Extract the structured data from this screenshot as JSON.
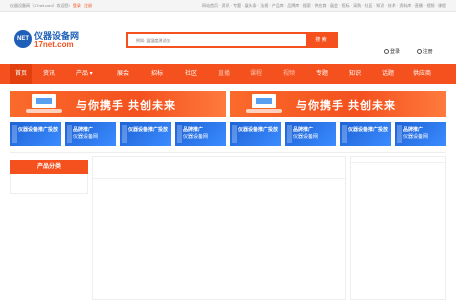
{
  "topbar": {
    "welcome": "仪器设备网（17net.com）欢迎您!",
    "login": "登录",
    "register": "注册",
    "links": "网站首页 · 资讯 · 专题 · 展头条 · 法规 · 产品库 · 品牌库 · 搜索 · 供应商 · 展会 · 招标 · 采购 · 社区 · 知识 · 技术 · 资料库 · 直播 · 视频 · 课程"
  },
  "logo": {
    "badge": "NET",
    "cn": "仪器设备网",
    "en": "17net.com"
  },
  "search": {
    "placeholder": "例如: 温湿度测试仪",
    "button": "搜 索"
  },
  "user": {
    "login": "登录",
    "register": "注册"
  },
  "nav": {
    "items": [
      "首页",
      "资讯",
      "产品 ▾",
      "展会",
      "招标",
      "社区",
      "直播",
      "课程",
      "视频",
      "专题",
      "知识",
      "话题",
      "供应商"
    ]
  },
  "banners": [
    {
      "slogan": "与你携手 共创未来"
    },
    {
      "slogan": "与你携手 共创未来"
    }
  ],
  "ads": [
    {
      "title": "仪器设备推广投放",
      "sub": ""
    },
    {
      "title": "品牌推广",
      "sub": "仪器设备网"
    },
    {
      "title": "仪器设备推广投放",
      "sub": ""
    },
    {
      "title": "品牌推广",
      "sub": "仪器设备网"
    },
    {
      "title": "仪器设备推广投放",
      "sub": ""
    },
    {
      "title": "品牌推广",
      "sub": "仪器设备网"
    },
    {
      "title": "仪器设备推广投放",
      "sub": ""
    },
    {
      "title": "品牌推广",
      "sub": "仪器设备网"
    }
  ],
  "category": {
    "title": "产品分类"
  },
  "colors": {
    "accent": "#f4511e",
    "brand_blue": "#1f5fb8"
  }
}
